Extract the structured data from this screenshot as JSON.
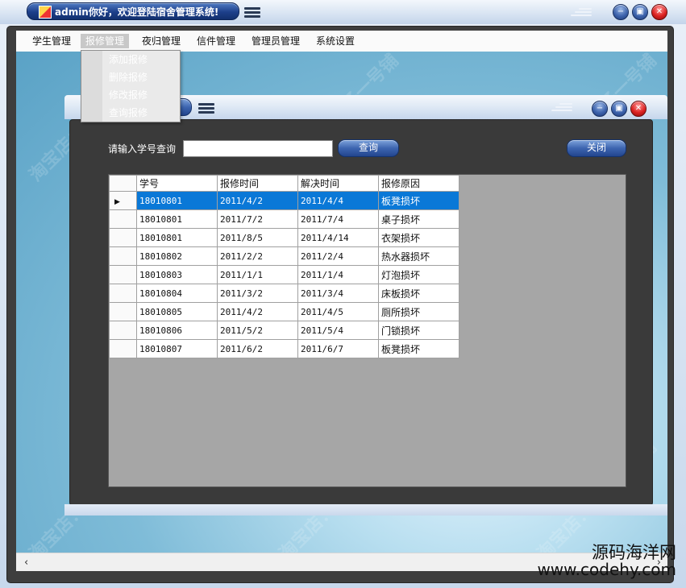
{
  "window": {
    "title": "admin你好，欢迎登陆宿舍管理系统!"
  },
  "menubar": {
    "items": [
      "学生管理",
      "报修管理",
      "夜归管理",
      "信件管理",
      "管理员管理",
      "系统设置"
    ],
    "active_index": 1
  },
  "dropdown": {
    "items": [
      "添加报修",
      "删除报修",
      "修改报修",
      "查询报修"
    ]
  },
  "child": {
    "search_label": "请输入学号查询",
    "search_value": "",
    "query_button": "查询",
    "close_button": "关闭"
  },
  "grid": {
    "columns": [
      "学号",
      "报修时间",
      "解决时间",
      "报修原因"
    ],
    "selected_row": 0,
    "rows": [
      [
        "18010801",
        "2011/4/2",
        "2011/4/4",
        "板凳损坏"
      ],
      [
        "18010801",
        "2011/7/2",
        "2011/7/4",
        "桌子损坏"
      ],
      [
        "18010801",
        "2011/8/5",
        "2011/4/14",
        "衣架损坏"
      ],
      [
        "18010802",
        "2011/2/2",
        "2011/2/4",
        "热水器损坏"
      ],
      [
        "18010803",
        "2011/1/1",
        "2011/1/4",
        "灯泡损坏"
      ],
      [
        "18010804",
        "2011/3/2",
        "2011/3/4",
        "床板损坏"
      ],
      [
        "18010805",
        "2011/4/2",
        "2011/4/5",
        "厕所损坏"
      ],
      [
        "18010806",
        "2011/5/2",
        "2011/5/4",
        "门锁损坏"
      ],
      [
        "18010807",
        "2011/6/2",
        "2011/6/7",
        "板凳损坏"
      ]
    ]
  },
  "watermark": {
    "site_cn": "源码海洋网",
    "site_en": "www.codehy.com",
    "shop_text": "淘宝店：豆子一号铺"
  },
  "icons": {
    "outer_minimize": "minimize-icon",
    "outer_maximize": "maximize-icon",
    "outer_close": "close-icon",
    "row_pointer": "row-pointer-icon"
  },
  "colors": {
    "selection": "#0a78d7",
    "frame": "#3e3e3e",
    "button": "#3d65b0",
    "close": "#dd2222"
  }
}
